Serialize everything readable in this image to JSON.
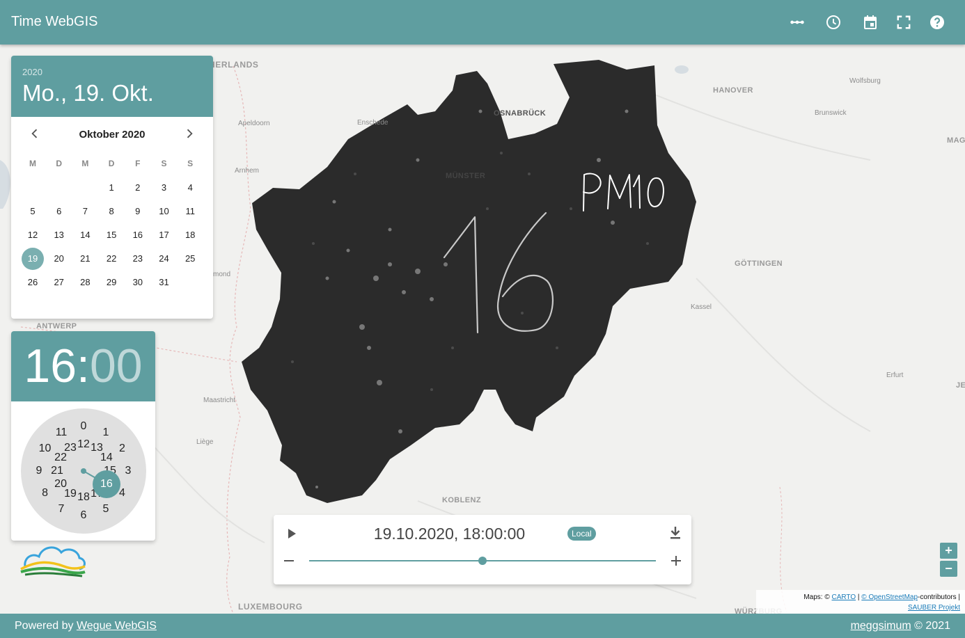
{
  "header": {
    "title": "Time WebGIS",
    "icons": [
      "dots-icon",
      "clock-icon",
      "calendar-icon",
      "fullscreen-icon",
      "help-icon"
    ]
  },
  "map": {
    "labels": {
      "netherlands": "HERLANDS",
      "apeldoorn": "Apeldoorn",
      "enschede": "Enschede",
      "osnabrueck": "OSNABRÜCK",
      "muenster": "MÜNSTER",
      "arnhem": "Arnhem",
      "hanover": "HANOVER",
      "wolfsburg": "Wolfsburg",
      "brunswick": "Brunswick",
      "mag": "MAG",
      "goettingen": "GÖTTINGEN",
      "kassel": "Kassel",
      "erfurt": "Erfurt",
      "je": "JE",
      "antwerp": "ANTWERP",
      "mond": "mond",
      "maastricht": "Maastricht",
      "liege": "Liège",
      "koblenz": "KOBLENZ",
      "luxembourg": "LUXEMBOURG",
      "wuerzburg": "WÜRZBURG"
    },
    "overlay": {
      "pollutant": "PM10",
      "hour": "16"
    }
  },
  "datepicker": {
    "year": "2020",
    "title": "Mo., 19. Okt.",
    "month_label": "Oktober 2020",
    "weekdays": [
      "M",
      "D",
      "M",
      "D",
      "F",
      "S",
      "S"
    ],
    "weeks": [
      [
        "",
        "",
        "",
        "1",
        "2",
        "3",
        "4"
      ],
      [
        "5",
        "6",
        "7",
        "8",
        "9",
        "10",
        "11"
      ],
      [
        "12",
        "13",
        "14",
        "15",
        "16",
        "17",
        "18"
      ],
      [
        "19",
        "20",
        "21",
        "22",
        "23",
        "24",
        "25"
      ],
      [
        "26",
        "27",
        "28",
        "29",
        "30",
        "31",
        ""
      ]
    ],
    "selected_day": "19"
  },
  "timepicker": {
    "hour": "16",
    "separator": ":",
    "minute": "00",
    "outer_hours": [
      "0",
      "1",
      "2",
      "3",
      "4",
      "5",
      "6",
      "7",
      "8",
      "9",
      "10",
      "11"
    ],
    "inner_hours": [
      "12",
      "13",
      "14",
      "15",
      "16",
      "17",
      "18",
      "19",
      "20",
      "21",
      "22",
      "23"
    ],
    "selected_hour": "16"
  },
  "time_slider": {
    "datetime": "19.10.2020, 18:00:00",
    "timezone_chip": "Local",
    "position_fraction": 0.5
  },
  "zoom": {
    "in_label": "+",
    "out_label": "−"
  },
  "attribution": {
    "prefix": "Maps: ©",
    "carto": "CARTO",
    "separator1": "|",
    "osm": "© OpenStreetMap",
    "contributors": "-contributors |",
    "project": "SAUBER Projekt"
  },
  "footer": {
    "powered_by": "Powered by",
    "powered_link": "Wegue WebGIS",
    "author_link": "meggsimum",
    "copyright": "© 2021"
  },
  "colors": {
    "accent": "#5f9ea0",
    "raster": "#2b2b2b"
  }
}
